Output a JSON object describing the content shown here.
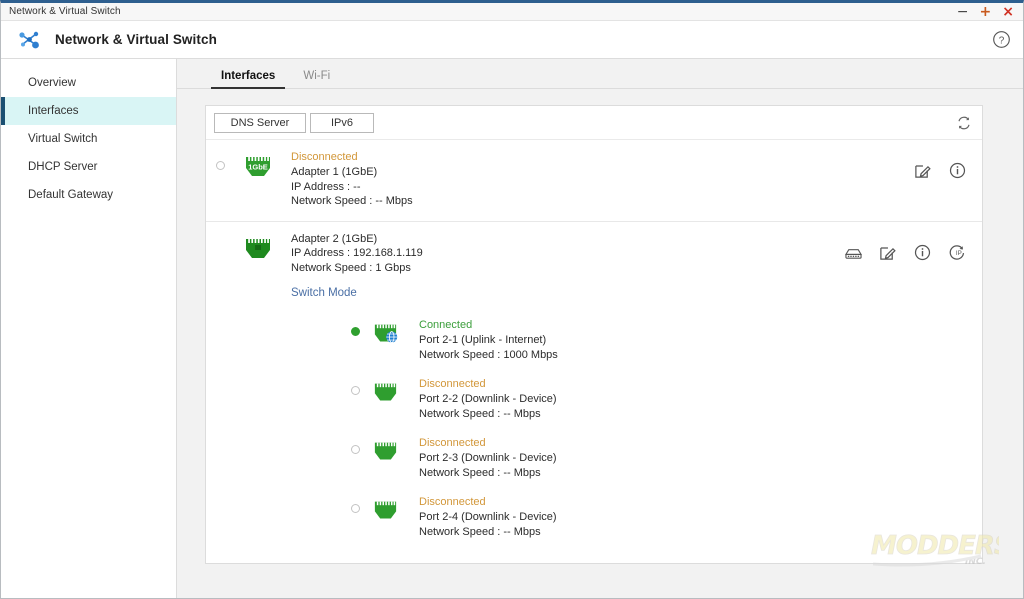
{
  "window": {
    "titlebar_text": "Network & Virtual Switch",
    "minimize_label": "−",
    "maximize_label": "+",
    "close_label": "×"
  },
  "header": {
    "title": "Network & Virtual Switch",
    "logo_icon": "network-nodes-icon",
    "help_icon": "help-circle-icon"
  },
  "sidebar": {
    "items": [
      {
        "label": "Overview",
        "active": false
      },
      {
        "label": "Interfaces",
        "active": true
      },
      {
        "label": "Virtual Switch",
        "active": false
      },
      {
        "label": "DHCP Server",
        "active": false
      },
      {
        "label": "Default Gateway",
        "active": false
      }
    ]
  },
  "tabs": [
    {
      "label": "Interfaces",
      "active": true
    },
    {
      "label": "Wi-Fi",
      "active": false
    }
  ],
  "toolbar": {
    "dns_server_label": "DNS Server",
    "ipv6_label": "IPv6",
    "refresh_icon": "refresh-icon"
  },
  "adapters": [
    {
      "status": "Disconnected",
      "status_state": "disconnected",
      "name": "Adapter 1 (1GbE)",
      "ip_address": "IP Address : --",
      "network_speed": "Network Speed : -- Mbps",
      "nic_badge": "1GbE",
      "selected": false,
      "actions": [
        "edit-icon",
        "info-icon"
      ]
    },
    {
      "status": "",
      "status_state": "none",
      "name": "Adapter 2 (1GbE)",
      "ip_address": "IP Address : 192.168.1.119",
      "network_speed": "Network Speed : 1 Gbps",
      "nic_badge": "",
      "selected": false,
      "switch_mode_label": "Switch Mode",
      "actions": [
        "switch-device-icon",
        "edit-icon",
        "info-icon",
        "renew-ip-icon"
      ]
    }
  ],
  "ports": [
    {
      "status": "Connected",
      "status_state": "connected",
      "name": "Port 2-1 (Uplink - Internet)",
      "network_speed": "Network Speed : 1000 Mbps",
      "selected": true,
      "has_globe": true
    },
    {
      "status": "Disconnected",
      "status_state": "disconnected",
      "name": "Port 2-2 (Downlink - Device)",
      "network_speed": "Network Speed : -- Mbps",
      "selected": false,
      "has_globe": false
    },
    {
      "status": "Disconnected",
      "status_state": "disconnected",
      "name": "Port 2-3 (Downlink - Device)",
      "network_speed": "Network Speed : -- Mbps",
      "selected": false,
      "has_globe": false
    },
    {
      "status": "Disconnected",
      "status_state": "disconnected",
      "name": "Port 2-4 (Downlink - Device)",
      "network_speed": "Network Speed : -- Mbps",
      "selected": false,
      "has_globe": false
    }
  ],
  "watermark": {
    "main_text": "MODDERS",
    "sub_text": "INC."
  },
  "colors": {
    "accent_blue": "#2e5f8f",
    "sidebar_active_bg": "#d9f5f5",
    "connected_green": "#3b9e3b",
    "disconnected_orange": "#d2973a",
    "link_blue": "#4a6fa5",
    "nic_green": "#2f9e2f"
  }
}
